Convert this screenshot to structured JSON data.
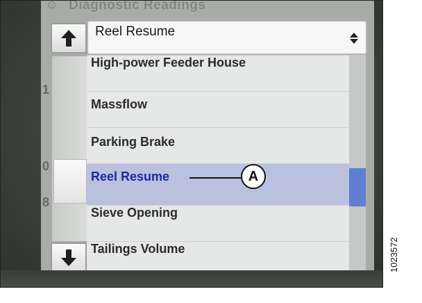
{
  "screen": {
    "heading": "Diagnostic Readings",
    "left_marks": [
      "1",
      "0",
      "8"
    ]
  },
  "dropdown": {
    "value": "Reel Resume"
  },
  "scroll": {
    "up_icon": "arrow-up-icon",
    "down_icon": "arrow-down-icon"
  },
  "list": {
    "items": [
      {
        "label": "High-power Feeder House",
        "selected": false
      },
      {
        "label": "Massflow",
        "selected": false
      },
      {
        "label": "Parking Brake",
        "selected": false
      },
      {
        "label": "Reel Resume",
        "selected": true
      },
      {
        "label": "Sieve Opening",
        "selected": false
      },
      {
        "label": "Tailings Volume",
        "selected": false
      }
    ]
  },
  "callout": {
    "letter": "A",
    "target": "Reel Resume"
  },
  "figure_id": "1023572",
  "colors": {
    "selected_row": "#b9c1de",
    "selected_text": "#1b2a9e",
    "scroll_indicator": "#5f7fd4"
  }
}
